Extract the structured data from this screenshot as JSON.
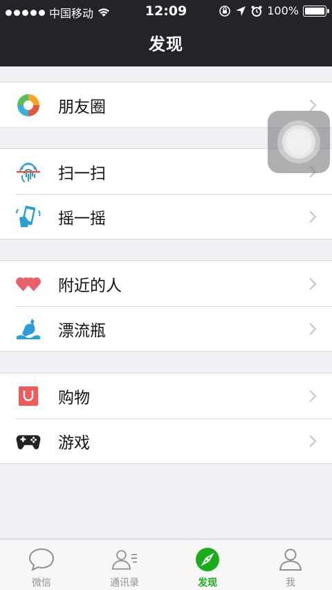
{
  "status_bar": {
    "carrier": "中国移动",
    "time": "12:09",
    "battery": "100%",
    "battery_level": 1.0
  },
  "nav": {
    "title": "发现"
  },
  "groups": [
    {
      "items": [
        {
          "label": "朋友圈",
          "icon": "moments-icon"
        }
      ]
    },
    {
      "items": [
        {
          "label": "扫一扫",
          "icon": "scan-icon"
        },
        {
          "label": "摇一摇",
          "icon": "shake-icon"
        }
      ]
    },
    {
      "items": [
        {
          "label": "附近的人",
          "icon": "nearby-people-icon"
        },
        {
          "label": "漂流瓶",
          "icon": "drift-bottle-icon"
        }
      ]
    },
    {
      "items": [
        {
          "label": "购物",
          "icon": "shopping-icon"
        },
        {
          "label": "游戏",
          "icon": "games-icon"
        }
      ]
    }
  ],
  "tabbar": {
    "tabs": [
      {
        "label": "微信",
        "icon": "chat-bubble-icon",
        "active": false
      },
      {
        "label": "通讯录",
        "icon": "contacts-icon",
        "active": false
      },
      {
        "label": "发现",
        "icon": "compass-icon",
        "active": true
      },
      {
        "label": "我",
        "icon": "person-icon",
        "active": false
      }
    ]
  },
  "colors": {
    "nav_bg": "#222427",
    "accent_green": "#1aad19",
    "page_bg": "#efeff4"
  }
}
